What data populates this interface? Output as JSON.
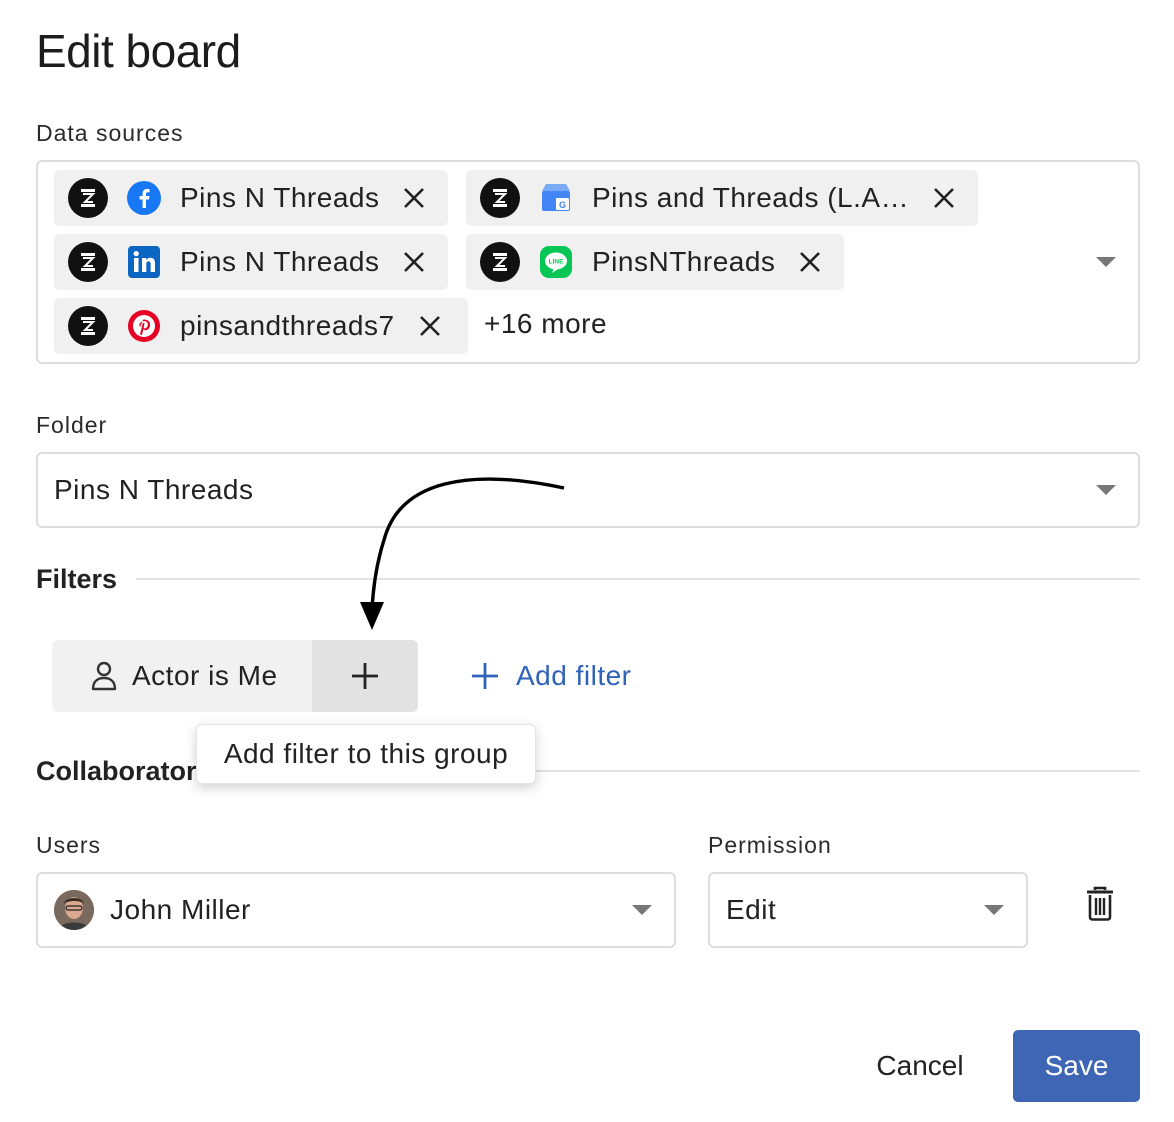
{
  "dialog": {
    "title": "Edit board"
  },
  "data_sources": {
    "label": "Data sources",
    "chips": [
      {
        "network": "facebook-icon",
        "name": "Pins N Threads"
      },
      {
        "network": "google-business-icon",
        "name": "Pins and Threads (L.A…"
      },
      {
        "network": "linkedin-icon",
        "name": "Pins N Threads"
      },
      {
        "network": "line-icon",
        "name": "PinsNThreads"
      },
      {
        "network": "pinterest-icon",
        "name": "pinsandthreads7"
      }
    ],
    "more": "+16 more"
  },
  "folder": {
    "label": "Folder",
    "value": "Pins N Threads"
  },
  "filters": {
    "section_title": "Filters",
    "active_filter": "Actor is Me",
    "add_filter_label": "Add filter",
    "tooltip": "Add filter to this group"
  },
  "collaborators": {
    "section_title": "Collaborator",
    "users_label": "Users",
    "permission_label": "Permission",
    "user_value": "John Miller",
    "permission_value": "Edit"
  },
  "footer": {
    "cancel_label": "Cancel",
    "save_label": "Save"
  },
  "colors": {
    "accent": "#3f66b4",
    "link": "#2f62b8",
    "chip_bg": "#f0f0f0"
  }
}
